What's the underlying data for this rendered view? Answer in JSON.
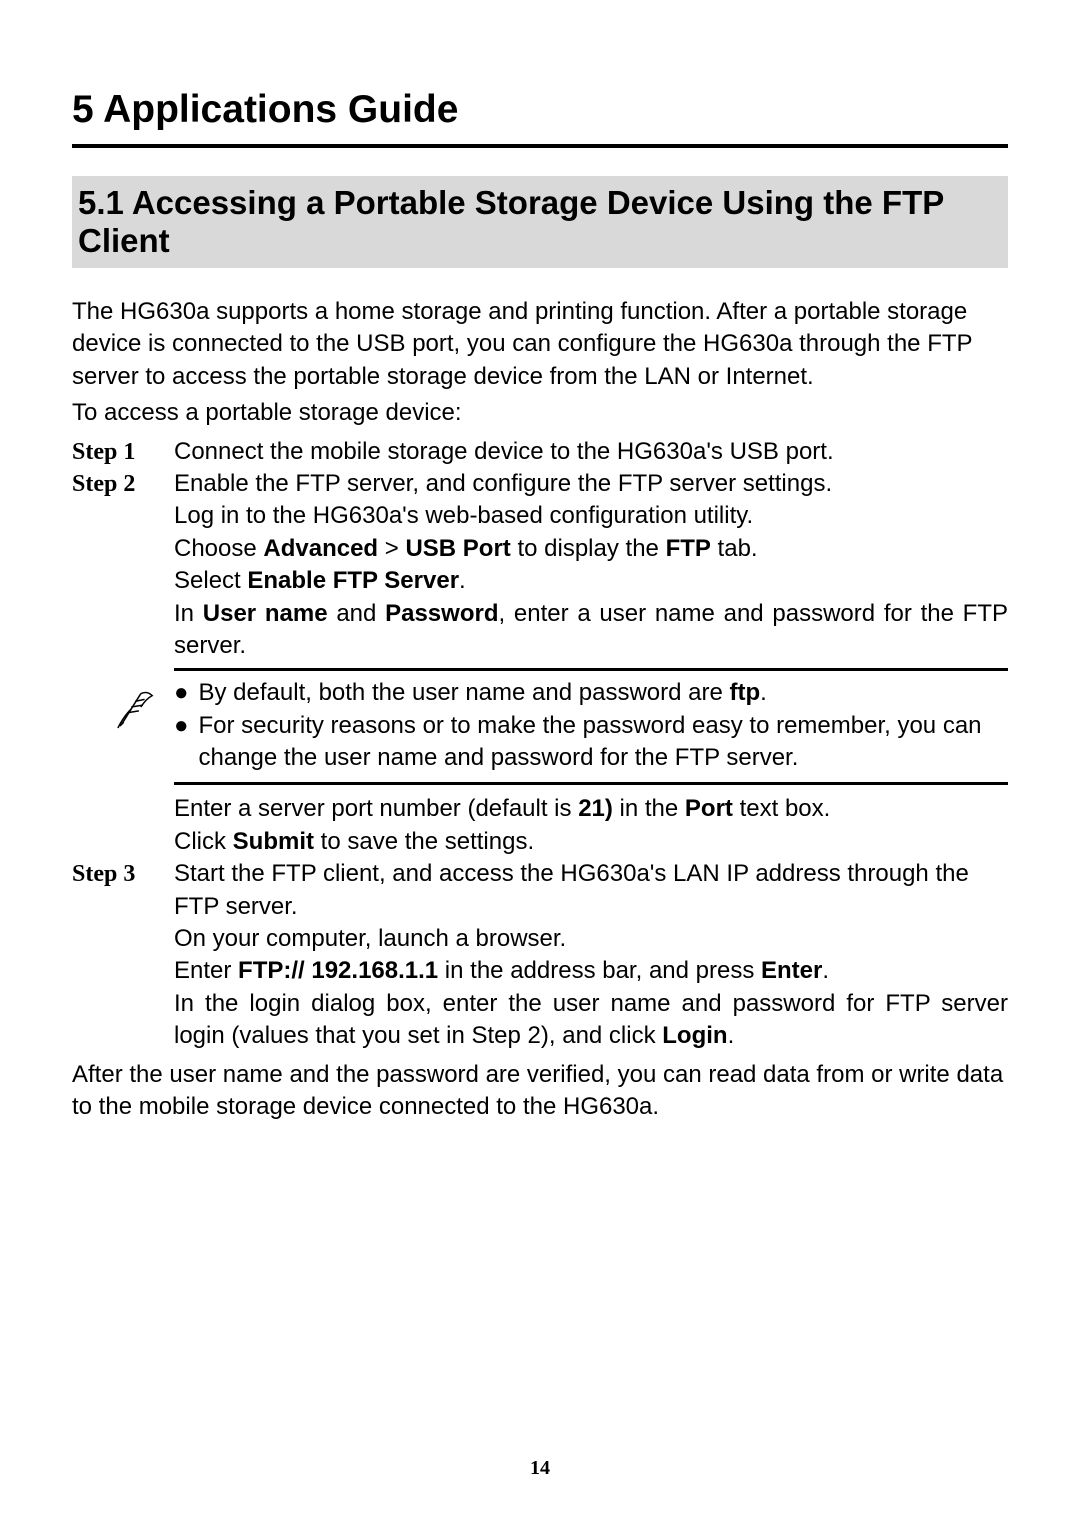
{
  "chapter": {
    "title": "5 Applications Guide"
  },
  "section": {
    "title": "5.1 Accessing a Portable Storage Device Using the FTP Client"
  },
  "intro": {
    "p1": "The HG630a supports a home storage and printing function. After a portable storage device is connected to the USB port, you can configure the HG630a through the FTP server to access the portable storage device from the LAN or Internet.",
    "p2": "To access a portable storage device:"
  },
  "steps": {
    "s1": {
      "label": "Step 1",
      "text": "Connect the mobile storage device to the HG630a's USB port."
    },
    "s2": {
      "label": "Step 2",
      "l1": "Enable the FTP server, and configure the FTP server settings.",
      "l2": "Log in to the HG630a's web-based configuration utility.",
      "l3a": "Choose ",
      "l3b": "Advanced",
      "l3c": " > ",
      "l3d": "USB Port",
      "l3e": " to display the ",
      "l3f": "FTP",
      "l3g": " tab.",
      "l4a": "Select ",
      "l4b": "Enable FTP Server",
      "l4c": ".",
      "l5a": "In ",
      "l5b": "User name",
      "l5c": " and ",
      "l5d": "Password",
      "l5e": ", enter a user name and password for the FTP server.",
      "note": {
        "b1a": "By default, both the user name and password are ",
        "b1b": "ftp",
        "b1c": ".",
        "b2": "For security reasons or to make the password easy to remember, you can change the user name and password for the FTP server."
      },
      "l6a": "Enter a server port number (default is ",
      "l6b": "21)",
      "l6c": " in the ",
      "l6d": "Port",
      "l6e": " text box.",
      "l7a": "Click ",
      "l7b": "Submit",
      "l7c": " to save the settings."
    },
    "s3": {
      "label": "Step 3",
      "l1": "Start the FTP client, and access the HG630a's LAN IP address through the FTP server.",
      "l2": "On your computer, launch a browser.",
      "l3a": "Enter ",
      "l3b": "FTP:// 192.168.1.1",
      "l3c": " in the address bar, and press ",
      "l3d": "Enter",
      "l3e": ".",
      "l4a": "In the login dialog box, enter the user name and password for FTP server login (values that you set in Step 2), and click ",
      "l4b": "Login",
      "l4c": "."
    }
  },
  "closing": "After the user name and the password are verified, you can read data from or write data to the mobile storage device connected to the HG630a.",
  "pageNumber": "14"
}
